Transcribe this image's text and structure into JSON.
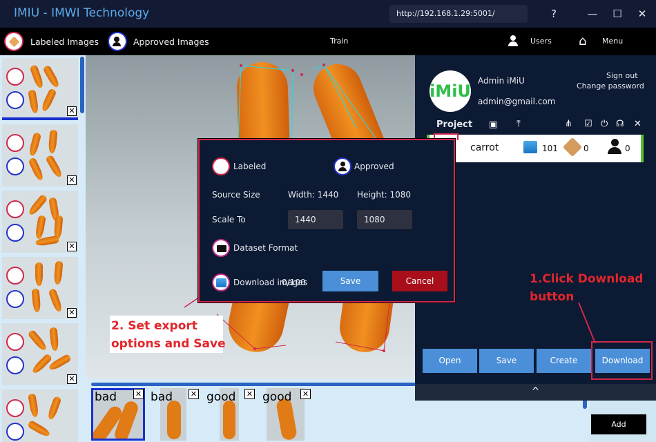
{
  "window": {
    "title": "IMIU - IMWI Technology",
    "url": "http://192.168.1.29:5001/",
    "help": "?",
    "minimize": "—",
    "maximize": "☐",
    "close": "✕"
  },
  "toolbar": {
    "labeled": "Labeled Images",
    "approved": "Approved Images",
    "train": "Train",
    "users": "Users",
    "menu": "Menu"
  },
  "user": {
    "avatar_text": "iMiU",
    "name": "Admin iMiU",
    "email": "admin@gmail.com",
    "sign_out": "Sign out",
    "change_password": "Change password"
  },
  "project": {
    "header": "Project",
    "name": "carrot",
    "images": "101",
    "tags": "0",
    "approved": "0"
  },
  "panel_buttons": {
    "open": "Open",
    "save": "Save",
    "create": "Create",
    "download": "Download",
    "collapse": "^"
  },
  "modal": {
    "labeled": "Labeled",
    "approved": "Approved",
    "source_size": "Source Size",
    "width_label": "Width: 1440",
    "height_label": "Height: 1080",
    "scale_to": "Scale To",
    "scale_width": "1440",
    "scale_height": "1080",
    "dataset_format": "Dataset Format",
    "download_images": "Download images",
    "progress": "0/100",
    "save": "Save",
    "cancel": "Cancel"
  },
  "bottom_thumbs": [
    {
      "label": "bad"
    },
    {
      "label": "bad"
    },
    {
      "label": "good"
    },
    {
      "label": "good"
    }
  ],
  "add_button": "Add",
  "annotations": {
    "step1_line1": "1.Click Download",
    "step1_line2": "button",
    "step2_line1": "2. Set export",
    "step2_line2": "options and Save"
  },
  "colors": {
    "accent_blue": "#4a8fd8",
    "danger_red": "#a80f1a",
    "annotation_red": "#e2262c",
    "panel_bg": "#0c1a33"
  }
}
